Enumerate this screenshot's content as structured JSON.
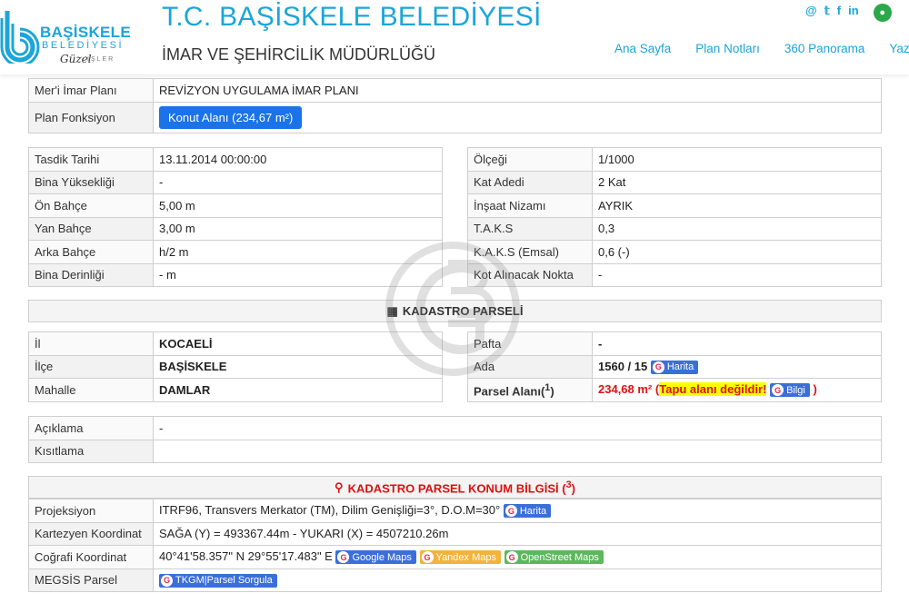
{
  "header": {
    "logo_text": "BAŞİSKELE",
    "logo_sub": "BELEDİYESİ",
    "logo_slogan": "Güzel",
    "logo_slogan2": "İŞLER",
    "title": "T.C. BAŞİSKELE BELEDİYESİ",
    "subtitle": "İMAR VE ŞEHİRCİLİK MÜDÜRLÜĞÜ",
    "social": [
      "@",
      "𝕥",
      "f",
      "in"
    ],
    "nav": [
      "Ana Sayfa",
      "Plan Notları",
      "360 Panorama",
      "Yazd"
    ]
  },
  "plan": {
    "rows": [
      {
        "label": "Mer'i İmar Planı",
        "value": "REVİZYON UYGULAMA İMAR PLANI"
      },
      {
        "label": "Plan Fonksiyon",
        "value": "Konut Alanı (234,67 m²)"
      }
    ]
  },
  "details_left": [
    {
      "label": "Tasdik Tarihi",
      "value": "13.11.2014 00:00:00"
    },
    {
      "label": "Bina Yüksekliği",
      "value": "-"
    },
    {
      "label": "Ön Bahçe",
      "value": "5,00 m"
    },
    {
      "label": "Yan Bahçe",
      "value": "3,00 m"
    },
    {
      "label": "Arka Bahçe",
      "value": "h/2 m"
    },
    {
      "label": "Bina Derinliği",
      "value": "- m"
    }
  ],
  "details_right": [
    {
      "label": "Ölçeği",
      "value": "1/1000"
    },
    {
      "label": "Kat Adedi",
      "value": "2 Kat"
    },
    {
      "label": "İnşaat Nizamı",
      "value": "AYRIK"
    },
    {
      "label": "T.A.K.S",
      "value": "0,3"
    },
    {
      "label": "K.A.K.S (Emsal)",
      "value": "0,6 (-)"
    },
    {
      "label": "Kot Alınacak Nokta",
      "value": "-"
    }
  ],
  "kadastro": {
    "header": "KADASTRO PARSELİ",
    "left": [
      {
        "label": "İl",
        "value": "KOCAELİ"
      },
      {
        "label": "İlçe",
        "value": "BAŞİSKELE"
      },
      {
        "label": "Mahalle",
        "value": "DAMLAR"
      }
    ],
    "pafta_label": "Pafta",
    "pafta_value": "-",
    "ada_label": "Ada",
    "ada_value": "1560 / 15",
    "harita": "Harita",
    "parsel_label": "Parsel Alanı(",
    "parsel_sup": "1",
    "parsel_label_end": ")",
    "parsel_value": "234,68 m²",
    "paren_open": "(",
    "tapu_warning": "Tapu alanı değildir!",
    "bilgi": "Bilgi",
    "paren_close": ")"
  },
  "notes": [
    {
      "label": "Açıklama",
      "value": "-"
    },
    {
      "label": "Kısıtlama",
      "value": ""
    }
  ],
  "konum": {
    "header": "KADASTRO PARSEL KONUM BİLGİSİ (",
    "header_sup": "3",
    "header_end": ")",
    "projeksiyon_label": "Projeksiyon",
    "projeksiyon_value": "ITRF96, Transvers Merkator (TM), Dilim Genişliği=3°, D.O.M=30°",
    "harita": "Harita",
    "kartezyen_label": "Kartezyen Koordinat",
    "kartezyen_value": "SAĞA (Y) = 493367.44m - YUKARI (X) = 4507210.26m",
    "cografi_label": "Coğrafi Koordinat",
    "cografi_value": "40°41'58.357\" N 29°55'17.483\" E",
    "google": "Google Maps",
    "yandex": "Yandex Maps",
    "osm": "OpenStreet Maps",
    "megsis_label": "MEGSİS Parsel",
    "tkgm": "TKGM|Parsel Sorgula"
  },
  "colors": {
    "accent": "#1aa6d9",
    "button": "#1a73e8",
    "alert": "#dd1111"
  }
}
